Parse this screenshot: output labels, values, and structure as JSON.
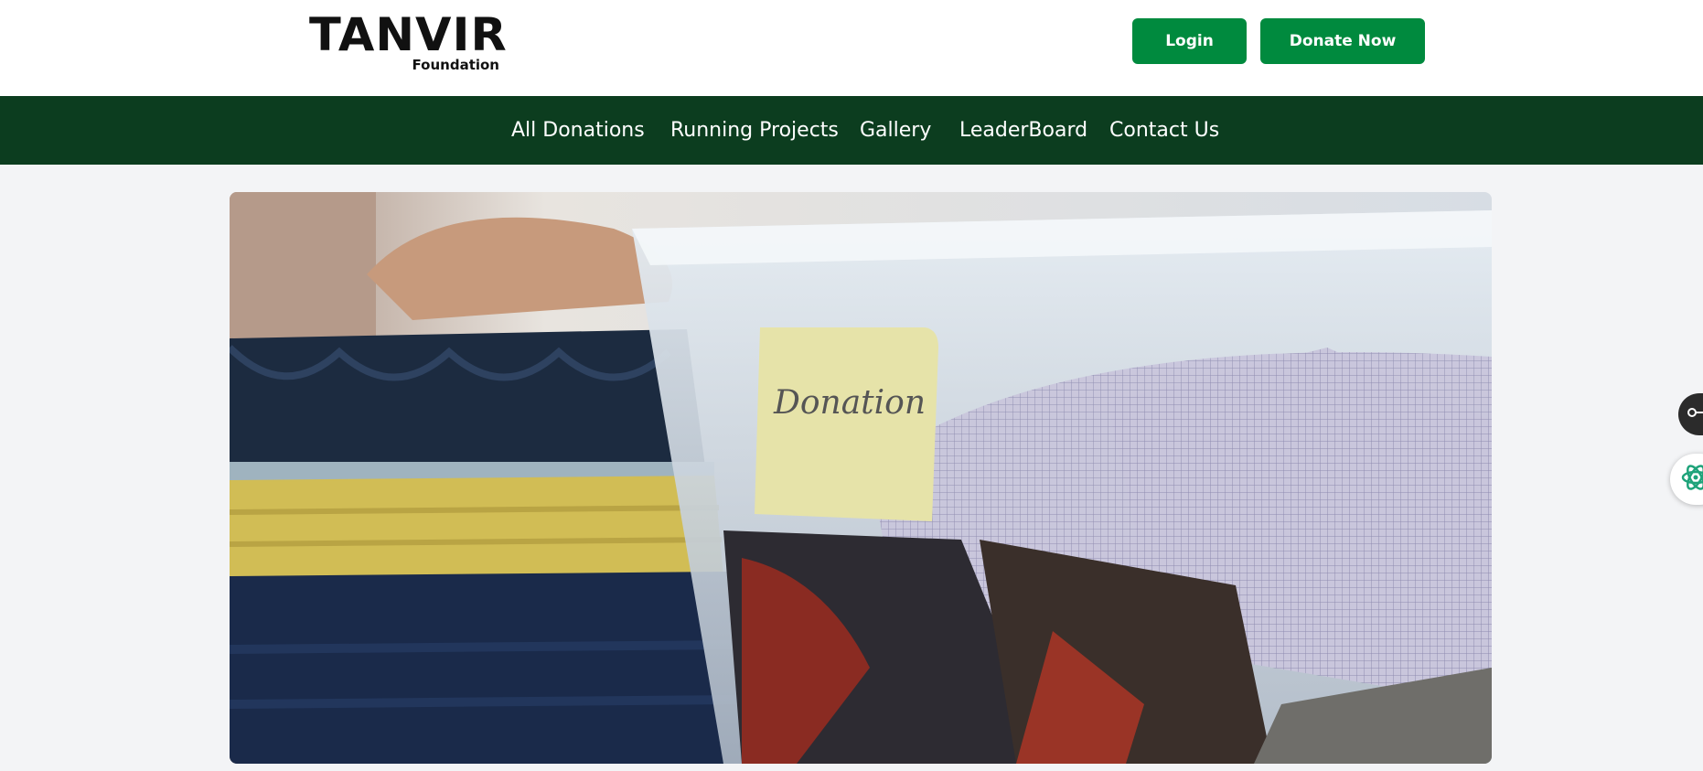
{
  "brand": {
    "name": "TANVIR",
    "tagline": "Foundation"
  },
  "header": {
    "login_label": "Login",
    "donate_label": "Donate Now"
  },
  "nav": {
    "items": [
      {
        "label": "All Donations"
      },
      {
        "label": "Running Projects"
      },
      {
        "label": "Gallery"
      },
      {
        "label": "LeaderBoard"
      },
      {
        "label": "Contact Us"
      }
    ]
  },
  "hero": {
    "note_text": "Donation"
  },
  "colors": {
    "accent": "#008a3e",
    "nav_bg": "#0c3d1f",
    "page_bg": "#f3f4f6"
  },
  "icons": [
    "slider-toggle-icon",
    "atom-icon"
  ]
}
